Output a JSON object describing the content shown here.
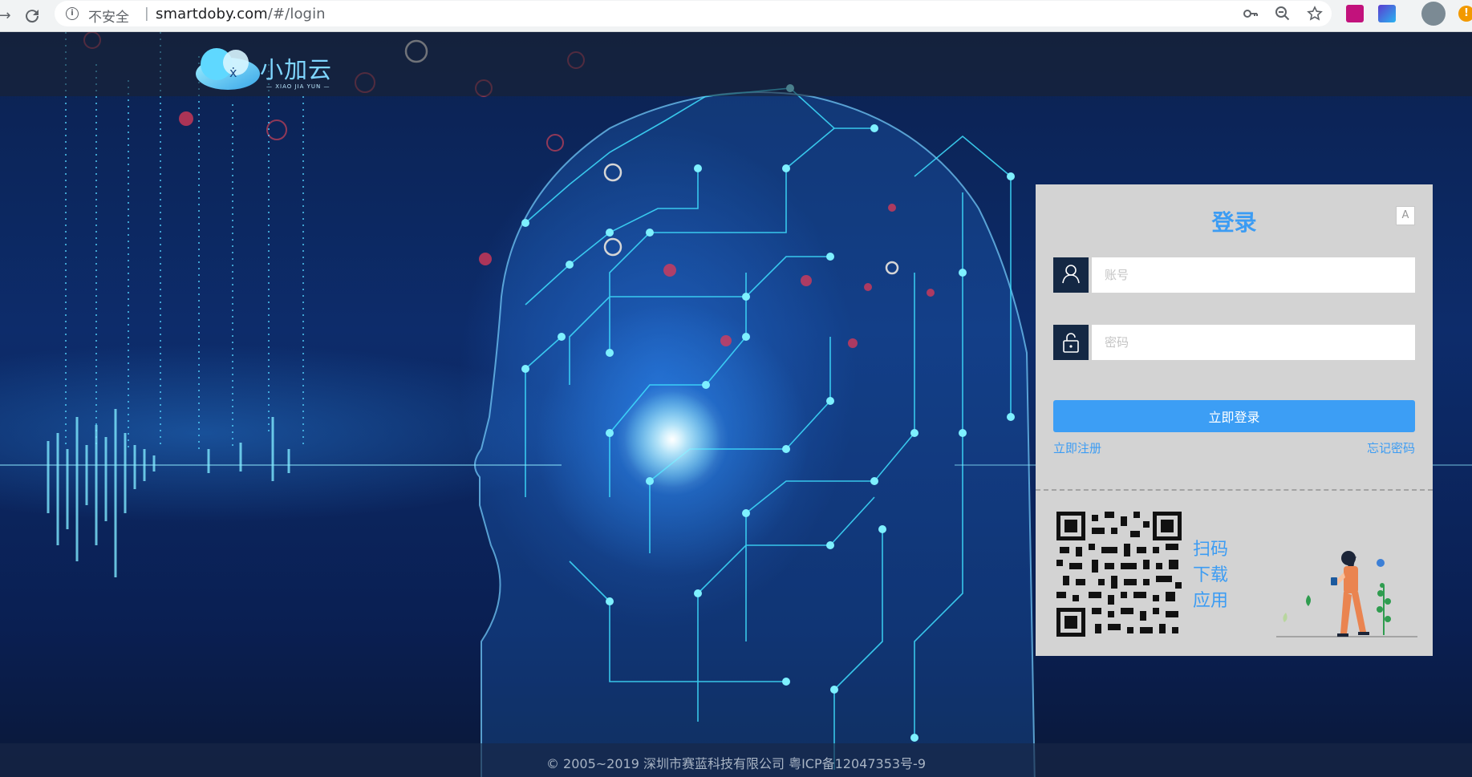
{
  "browser": {
    "security_label": "不安全",
    "separator": "|",
    "url_host": "smartdoby.com",
    "url_path": "/#/login",
    "icons": [
      "back-icon",
      "reload-icon",
      "info-icon",
      "key-icon",
      "zoom-out-icon",
      "star-icon",
      "axure-rp-extension-icon",
      "video-extension-icon",
      "profile-avatar",
      "update-warning-icon"
    ],
    "warning_symbol": "!"
  },
  "brand": {
    "name": "小加云",
    "subtitle": "— XIAO JIA YUN —",
    "colors": {
      "primary": "#3c9cf3",
      "panel_bg": "#d3d3d3",
      "icon_bg": "#142844"
    }
  },
  "login": {
    "title": "登录",
    "lang_icon": "A",
    "account_placeholder": "账号",
    "password_placeholder": "密码",
    "account_value": "",
    "password_value": "",
    "submit_label": "立即登录",
    "register_label": "立即注册",
    "forgot_label": "忘记密码"
  },
  "app_download": {
    "line1": "扫码",
    "line2": "下载",
    "line3": "应用"
  },
  "footer": {
    "copyright": "© 2005~2019 深圳市赛蓝科技有限公司  粤ICP备12047353号-9"
  }
}
